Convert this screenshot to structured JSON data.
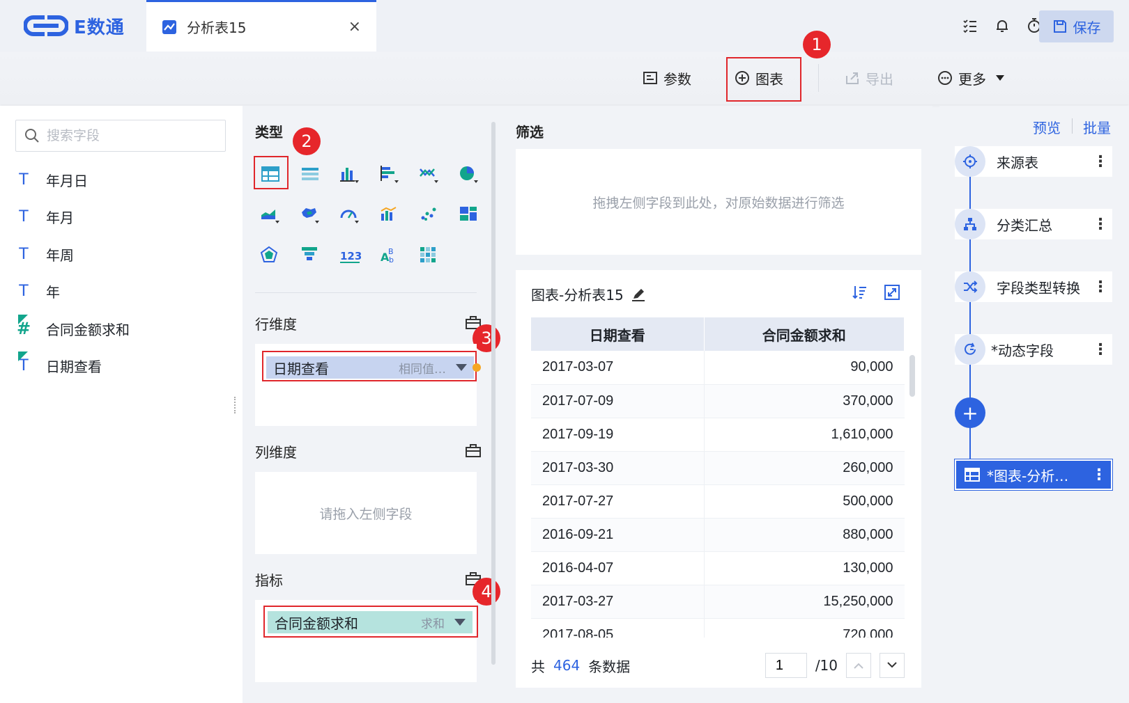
{
  "app": {
    "logo_text": "E数通"
  },
  "tab": {
    "title": "分析表15",
    "close": "×"
  },
  "toolbar": {
    "params": "参数",
    "chart": "图表",
    "export": "导出",
    "more": "更多",
    "save": "保存"
  },
  "badges": [
    "1",
    "2",
    "3",
    "4"
  ],
  "search": {
    "placeholder": "搜索字段"
  },
  "fields": [
    {
      "type": "T",
      "name": "年月日"
    },
    {
      "type": "T",
      "name": "年月"
    },
    {
      "type": "T",
      "name": "年周"
    },
    {
      "type": "T",
      "name": "年"
    },
    {
      "type": "#",
      "name": "合同金额求和"
    },
    {
      "type": "T",
      "name": "日期查看"
    }
  ],
  "config": {
    "type_title": "类型",
    "row_dim_title": "行维度",
    "row_dim_chip": {
      "label": "日期查看",
      "sub": "相同值…"
    },
    "col_dim_title": "列维度",
    "col_dim_placeholder": "请拖入左侧字段",
    "metric_title": "指标",
    "metric_chip": {
      "label": "合同金额求和",
      "sub": "求和"
    }
  },
  "filter": {
    "title": "筛选",
    "placeholder": "拖拽左侧字段到此处，对原始数据进行筛选"
  },
  "table": {
    "title": "图表-分析表15",
    "headers": [
      "日期查看",
      "合同金额求和"
    ],
    "rows": [
      [
        "2017-03-07",
        "90,000"
      ],
      [
        "2017-07-09",
        "370,000"
      ],
      [
        "2017-09-19",
        "1,610,000"
      ],
      [
        "2017-03-30",
        "260,000"
      ],
      [
        "2017-07-27",
        "500,000"
      ],
      [
        "2016-09-21",
        "880,000"
      ],
      [
        "2016-04-07",
        "130,000"
      ],
      [
        "2017-03-27",
        "15,250,000"
      ],
      [
        "2017-08-05",
        "720,000"
      ]
    ],
    "footer": {
      "prefix": "共",
      "count": "464",
      "suffix": "条数据",
      "page": "1",
      "total_pages": "/10"
    }
  },
  "flow": {
    "preview": "预览",
    "batch": "批量",
    "nodes": [
      {
        "label": "来源表"
      },
      {
        "label": "分类汇总"
      },
      {
        "label": "字段类型转换"
      },
      {
        "label": "*动态字段"
      }
    ],
    "add": "+",
    "active": "*图表-分析…"
  },
  "colors": {
    "accent": "#2d63e0",
    "highlight_red": "#e0262b",
    "row_chip": "#c7d4f0",
    "metric_chip": "#b5e3de"
  }
}
